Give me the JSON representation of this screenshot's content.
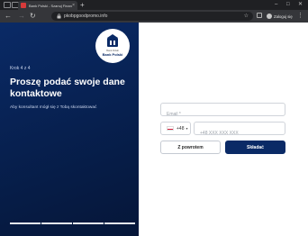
{
  "browser": {
    "tab_title": "Bank Polski - Szanuj Finansowo",
    "tab_close": "×",
    "new_tab": "+",
    "window_controls": {
      "minimize": "–",
      "maximize": "□",
      "close": "✕"
    },
    "nav": {
      "back": "←",
      "forward": "→",
      "reload": "↻"
    },
    "url": "pkobpgoodpromo.info",
    "star": "☆",
    "signin_label": "Zaloguj się",
    "menu": "⋮"
  },
  "left": {
    "logo_small": "Bank Polski",
    "logo_bank": "Bank Polski",
    "step": "Krok 4 z 4",
    "headline": "Proszę podać swoje dane kontaktowe",
    "subtext": "Aby konsultant mógł się z Tobą skontaktować",
    "progress_steps": 4
  },
  "form": {
    "email_placeholder": "Email *",
    "email_value": "",
    "phone_prefix": "+48",
    "phone_caret": "▾",
    "phone_placeholder": "+48 XXX XXX XXX",
    "phone_value": "",
    "back_label": "Z powrotem",
    "submit_label": "Składać"
  },
  "colors": {
    "brand_navy": "#0a2a66",
    "flag_red": "#d4213d"
  }
}
